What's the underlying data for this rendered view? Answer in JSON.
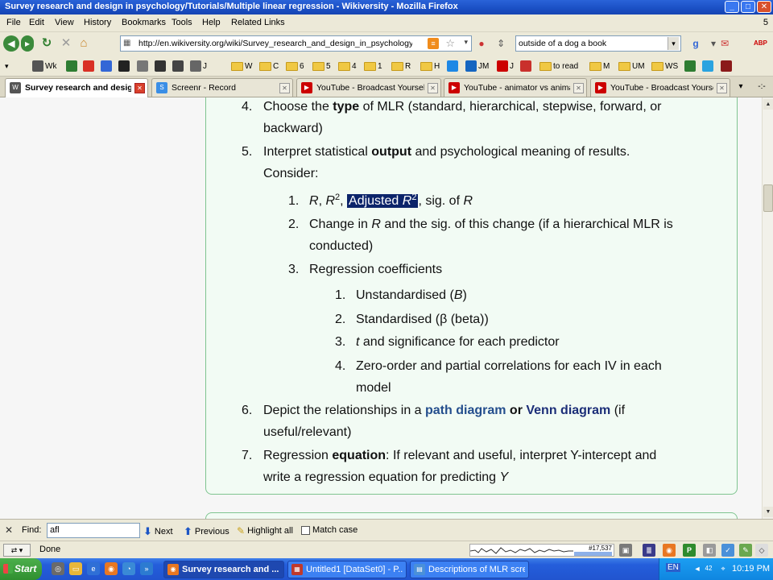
{
  "window": {
    "title": "Survey research and design in psychology/Tutorials/Multiple linear regression - Wikiversity - Mozilla Firefox",
    "min": "_",
    "max": "□",
    "close": "✕"
  },
  "menu": {
    "items": [
      "File",
      "Edit",
      "View",
      "History",
      "Bookmarks",
      "Tools",
      "Help",
      "Related Links"
    ],
    "right_count": "5"
  },
  "nav": {
    "url": "http://en.wikiversity.org/wiki/Survey_research_and_design_in_psychology/Tutorials/Multiple_linear_regression",
    "search_value": "outside of a dog a book"
  },
  "bookmarks": [
    {
      "label": "Wk",
      "icon": "sq",
      "color": "#444444"
    },
    {
      "label": "",
      "icon": "sq",
      "color": "#2e7d32"
    },
    {
      "label": "",
      "icon": "sq",
      "color": "#d93025"
    },
    {
      "label": "",
      "icon": "sq",
      "color": "#3367d6"
    },
    {
      "label": "",
      "icon": "sq",
      "color": "#000000"
    },
    {
      "label": "",
      "icon": "sq",
      "color": "#555555"
    },
    {
      "label": "J",
      "icon": "sq",
      "color": "#666666"
    },
    {
      "label": "W",
      "icon": "fold"
    },
    {
      "label": "C",
      "icon": "fold"
    },
    {
      "label": "6",
      "icon": "fold"
    },
    {
      "label": "5",
      "icon": "fold"
    },
    {
      "label": "4",
      "icon": "fold"
    },
    {
      "label": "1",
      "icon": "fold"
    },
    {
      "label": "R",
      "icon": "fold"
    },
    {
      "label": "H",
      "icon": "fold"
    },
    {
      "label": "JM",
      "icon": "sq",
      "color": "#1e88e5"
    },
    {
      "label": "J",
      "icon": "sq",
      "color": "#cc0000"
    },
    {
      "label": "to read",
      "icon": "fold"
    },
    {
      "label": "M",
      "icon": "fold"
    },
    {
      "label": "UM",
      "icon": "fold"
    },
    {
      "label": "WS",
      "icon": "fold"
    }
  ],
  "tabs": [
    {
      "label": "Survey research and design in ps...",
      "icon_color": "#555555",
      "active": true
    },
    {
      "label": "Screenr - Record",
      "icon_color": "#3a8ee6",
      "active": false
    },
    {
      "label": "YouTube - Broadcast Yourself.",
      "icon_color": "#cc0000",
      "active": false
    },
    {
      "label": "YouTube - animator vs animation",
      "icon_color": "#cc0000",
      "active": false
    },
    {
      "label": "YouTube - Broadcast Yourself.",
      "icon_color": "#cc0000",
      "active": false
    }
  ],
  "tab_icons": {
    "list": "▾",
    "more": "-:-"
  },
  "content": {
    "l1_num": "4.",
    "l1a": "Choose the ",
    "l1_bold": "type",
    "l1b": " of MLR (standard, hierarchical, stepwise, forward, or",
    "l1c": "backward)",
    "l2_num": "5.",
    "l2a": "Interpret statistical ",
    "l2_bold": "output",
    "l2b": " and psychological meaning of results.",
    "l2c": "Consider:",
    "s1_num": "1.",
    "s1_r": "R",
    "s1_comma1": ", ",
    "s1_r2": "R",
    "s1_sup": "2",
    "s1_comma2": ", ",
    "s1_sel": "Adjusted ",
    "s1_sel_r": "R",
    "s1_sel_sup": "2",
    "s1_rest": ", sig. of ",
    "s1_r_end": "R",
    "s2_num": "2.",
    "s2a": "Change in ",
    "s2_r": "R",
    "s2b": " and the sig. of this change (if a hierarchical MLR is",
    "s2c": "conducted)",
    "s3_num": "3.",
    "s3": "Regression coefficients",
    "t1_num": "1.",
    "t1a": "Unstandardised (",
    "t1_b": "B",
    "t1b": ")",
    "t2_num": "2.",
    "t2": "Standardised (β (beta))",
    "t3_num": "3.",
    "t3_t": "t",
    "t3": " and significance for each predictor",
    "t4_num": "4.",
    "t4a": "Zero-order and partial correlations for each IV in each",
    "t4b": "model",
    "l6_num": "6.",
    "l6a": "Depict the relationships in a ",
    "l6_link1": "path diagram",
    "l6_or": " or ",
    "l6_link2": "Venn diagram",
    "l6b": " (if",
    "l6c": "useful/relevant)",
    "l7_num": "7.",
    "l7a": "Regression ",
    "l7_bold": "equation",
    "l7b": ": If relevant and useful, interpret Y-intercept and",
    "l7c": "write a regression equation for predicting ",
    "l7_y": "Y"
  },
  "find": {
    "label": "Find:",
    "value": "afl",
    "next": "Next",
    "previous": "Previous",
    "highlight": "Highlight all",
    "match_case": "Match case"
  },
  "status": {
    "text": "Done",
    "counter": "#17,537",
    "progress": 0.26
  },
  "taskbar": {
    "start": "Start",
    "tasks": [
      {
        "label": "Survey research and ...",
        "active": true,
        "icon_color": "#e87722"
      },
      {
        "label": "Untitled1 [DataSet0] - P...",
        "active": false,
        "icon_color": "#c0392b"
      },
      {
        "label": "Descriptions of MLR scre...",
        "active": false,
        "icon_color": "#4a90d9"
      }
    ],
    "lang": "EN",
    "tray_num": "42",
    "clock": "10:19 PM"
  }
}
